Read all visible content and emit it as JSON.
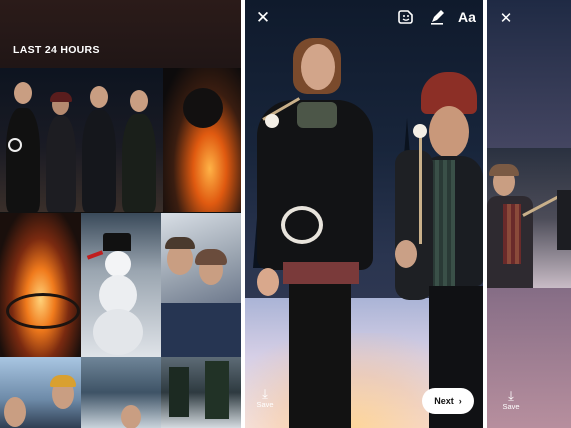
{
  "gallery": {
    "section_title": "LAST 24 HOURS",
    "tiles": [
      {
        "name": "group-photo"
      },
      {
        "name": "campfire-photo"
      },
      {
        "name": "fire-pit-photo"
      },
      {
        "name": "snowman-photo"
      },
      {
        "name": "selfie-photo"
      },
      {
        "name": "portrait-photo"
      },
      {
        "name": "snowy-trees-photo"
      },
      {
        "name": "forest-photo"
      }
    ]
  },
  "editor": {
    "close_icon": "close-icon",
    "sticker_icon": "sticker-icon",
    "pen_icon": "pen-icon",
    "text_tool_label": "Aa",
    "save_label": "Save",
    "next_label": "Next"
  },
  "preview": {
    "close_icon": "close-icon",
    "save_label": "Save"
  }
}
